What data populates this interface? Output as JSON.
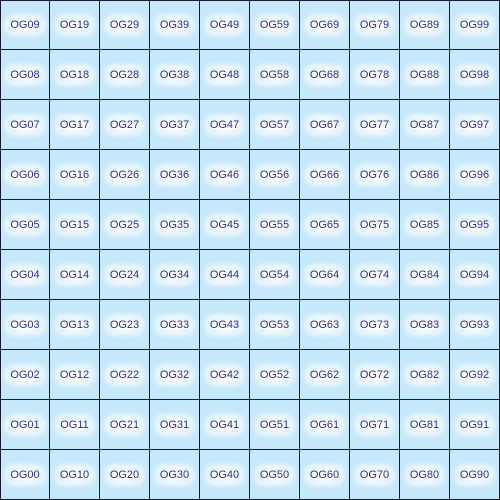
{
  "tile_grid": {
    "rows": [
      [
        "OG09",
        "OG19",
        "OG29",
        "OG39",
        "OG49",
        "OG59",
        "OG69",
        "OG79",
        "OG89",
        "OG99"
      ],
      [
        "OG08",
        "OG18",
        "OG28",
        "OG38",
        "OG48",
        "OG58",
        "OG68",
        "OG78",
        "OG88",
        "OG98"
      ],
      [
        "OG07",
        "OG17",
        "OG27",
        "OG37",
        "OG47",
        "OG57",
        "OG67",
        "OG77",
        "OG87",
        "OG97"
      ],
      [
        "OG06",
        "OG16",
        "OG26",
        "OG36",
        "OG46",
        "OG56",
        "OG66",
        "OG76",
        "OG86",
        "OG96"
      ],
      [
        "OG05",
        "OG15",
        "OG25",
        "OG35",
        "OG45",
        "OG55",
        "OG65",
        "OG75",
        "OG85",
        "OG95"
      ],
      [
        "OG04",
        "OG14",
        "OG24",
        "OG34",
        "OG44",
        "OG54",
        "OG64",
        "OG74",
        "OG84",
        "OG94"
      ],
      [
        "OG03",
        "OG13",
        "OG23",
        "OG33",
        "OG43",
        "OG53",
        "OG63",
        "OG73",
        "OG83",
        "OG93"
      ],
      [
        "OG02",
        "OG12",
        "OG22",
        "OG32",
        "OG42",
        "OG52",
        "OG62",
        "OG72",
        "OG82",
        "OG92"
      ],
      [
        "OG01",
        "OG11",
        "OG21",
        "OG31",
        "OG41",
        "OG51",
        "OG61",
        "OG71",
        "OG81",
        "OG91"
      ],
      [
        "OG00",
        "OG10",
        "OG20",
        "OG30",
        "OG40",
        "OG50",
        "OG60",
        "OG70",
        "OG80",
        "OG90"
      ]
    ]
  },
  "colors": {
    "tile_fill": "#c6e8fb",
    "grid_line": "#1a1a2e",
    "label_text": "#2a2aa0",
    "label_halo": "#ffffff"
  }
}
